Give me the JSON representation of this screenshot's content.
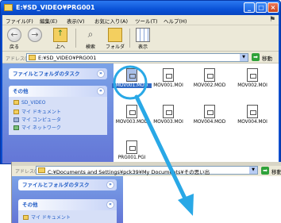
{
  "front_window": {
    "title": "E:¥SD_VIDEO¥PRG001",
    "menu": [
      "ファイル(F)",
      "編集(E)",
      "表示(V)",
      "お気に入り(A)",
      "ツール(T)",
      "ヘルプ(H)"
    ],
    "toolbar": {
      "back_label": "戻る",
      "forward_label": "",
      "up_label": "上へ",
      "search_label": "検索",
      "folders_label": "フォルダ",
      "view_label": "表示"
    },
    "address": {
      "label": "アドレス(D)",
      "value": "E:¥SD_VIDEO¥PRG001",
      "go_label": "移動"
    },
    "task_pane": {
      "file_tasks_title": "ファイルとフォルダのタスク",
      "other_title": "その他",
      "other_links": [
        "SD_VIDEO",
        "マイ ドキュメント",
        "マイ コンピュータ",
        "マイ ネットワーク"
      ]
    },
    "files": [
      "MOV001.MOD",
      "MOV001.MOI",
      "MOV002.MOD",
      "MOV002.MOI",
      "MOV003.MOD",
      "MOV003.MOI",
      "MOV004.MOD",
      "MOV004.MOI",
      "PRG001.PGI"
    ]
  },
  "back_window": {
    "address_label": "アドレス(D)",
    "address_value": "C:¥Documents and Settings¥pck39¥My Documents¥その思い出",
    "go_label": "移動",
    "task_pane": {
      "file_tasks_title": "ファイルとフォルダのタスク",
      "other_title": "その他",
      "other_links": [
        "マイ ドキュメント"
      ]
    }
  },
  "colors": {
    "titlebar": "#0a52d6",
    "selection": "#316ac5",
    "highlight_circle": "#29a8e6",
    "drag_arrow": "#29a8e6"
  }
}
